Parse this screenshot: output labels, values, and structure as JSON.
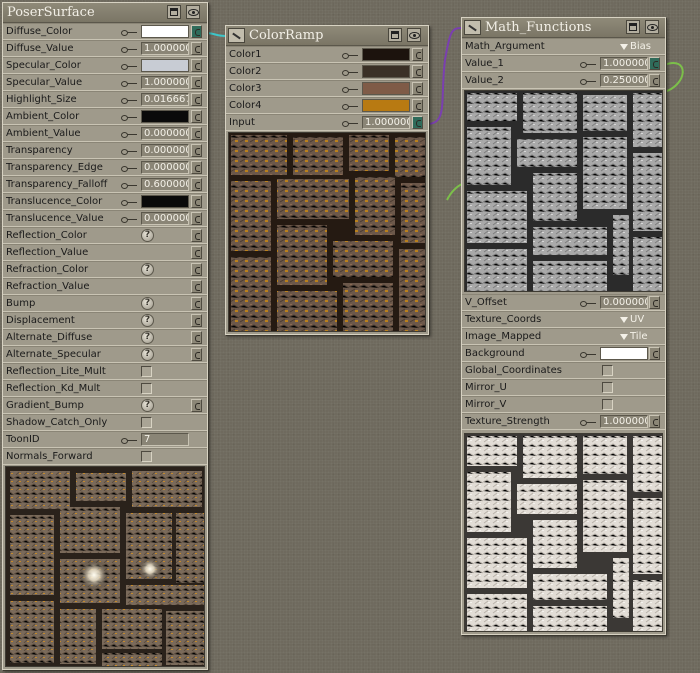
{
  "poser_surface": {
    "title": "PoserSurface",
    "rows": [
      {
        "label": "Diffuse_Color",
        "type": "swatch",
        "color": "#ffffff",
        "plugged": true
      },
      {
        "label": "Diffuse_Value",
        "type": "value",
        "value": "1.000000"
      },
      {
        "label": "Specular_Color",
        "type": "swatch",
        "color": "#c8ccd4"
      },
      {
        "label": "Specular_Value",
        "type": "value",
        "value": "1.000000"
      },
      {
        "label": "Highlight_Size",
        "type": "value",
        "value": "0.016667"
      },
      {
        "label": "Ambient_Color",
        "type": "swatch",
        "color": "#0a0a0a"
      },
      {
        "label": "Ambient_Value",
        "type": "value",
        "value": "0.000000"
      },
      {
        "label": "Transparency",
        "type": "value",
        "value": "0.000000"
      },
      {
        "label": "Transparency_Edge",
        "type": "value",
        "value": "0.000000"
      },
      {
        "label": "Transparency_Falloff",
        "type": "value",
        "value": "0.600000"
      },
      {
        "label": "Translucence_Color",
        "type": "swatch",
        "color": "#0a0a0a"
      },
      {
        "label": "Translucence_Value",
        "type": "value",
        "value": "0.000000"
      },
      {
        "label": "Reflection_Color",
        "type": "help"
      },
      {
        "label": "Reflection_Value",
        "type": "plug"
      },
      {
        "label": "Refraction_Color",
        "type": "help"
      },
      {
        "label": "Refraction_Value",
        "type": "plug"
      },
      {
        "label": "Bump",
        "type": "help"
      },
      {
        "label": "Displacement",
        "type": "help"
      },
      {
        "label": "Alternate_Diffuse",
        "type": "help"
      },
      {
        "label": "Alternate_Specular",
        "type": "help"
      },
      {
        "label": "Reflection_Lite_Mult",
        "type": "checkbox"
      },
      {
        "label": "Reflection_Kd_Mult",
        "type": "checkbox"
      },
      {
        "label": "Gradient_Bump",
        "type": "help"
      },
      {
        "label": "Shadow_Catch_Only",
        "type": "checkbox"
      },
      {
        "label": "ToonID",
        "type": "value",
        "value": "7"
      },
      {
        "label": "Normals_Forward",
        "type": "checkbox"
      }
    ]
  },
  "color_ramp": {
    "title": "ColorRamp",
    "rows": [
      {
        "label": "Color1",
        "type": "swatch",
        "color": "#1c130d"
      },
      {
        "label": "Color2",
        "type": "swatch",
        "color": "#3a3026"
      },
      {
        "label": "Color3",
        "type": "swatch",
        "color": "#7f5b47"
      },
      {
        "label": "Color4",
        "type": "swatch",
        "color": "#b87a12"
      },
      {
        "label": "Input",
        "type": "value",
        "value": "1.000000",
        "plugged": true
      }
    ]
  },
  "math_functions": {
    "title": "Math_Functions",
    "rows_top": [
      {
        "label": "Math_Argument",
        "type": "dropdown",
        "value": "Bias"
      },
      {
        "label": "Value_1",
        "type": "value",
        "value": "1.000000",
        "plugged": true
      },
      {
        "label": "Value_2",
        "type": "value",
        "value": "0.250000"
      }
    ],
    "rows_bottom": [
      {
        "label": "V_Offset",
        "type": "value",
        "value": "0.000000"
      },
      {
        "label": "Texture_Coords",
        "type": "dropdown",
        "value": "UV"
      },
      {
        "label": "Image_Mapped",
        "type": "dropdown",
        "value": "Tile"
      },
      {
        "label": "Background",
        "type": "swatch",
        "color": "#ffffff"
      },
      {
        "label": "Global_Coordinates",
        "type": "checkbox"
      },
      {
        "label": "Mirror_U",
        "type": "checkbox"
      },
      {
        "label": "Mirror_V",
        "type": "checkbox"
      },
      {
        "label": "Texture_Strength",
        "type": "value",
        "value": "1.000000"
      }
    ]
  },
  "colors": {
    "wire_teal": "#3ec6c9",
    "wire_purple": "#7a3fb0",
    "wire_green": "#7cc04a"
  }
}
